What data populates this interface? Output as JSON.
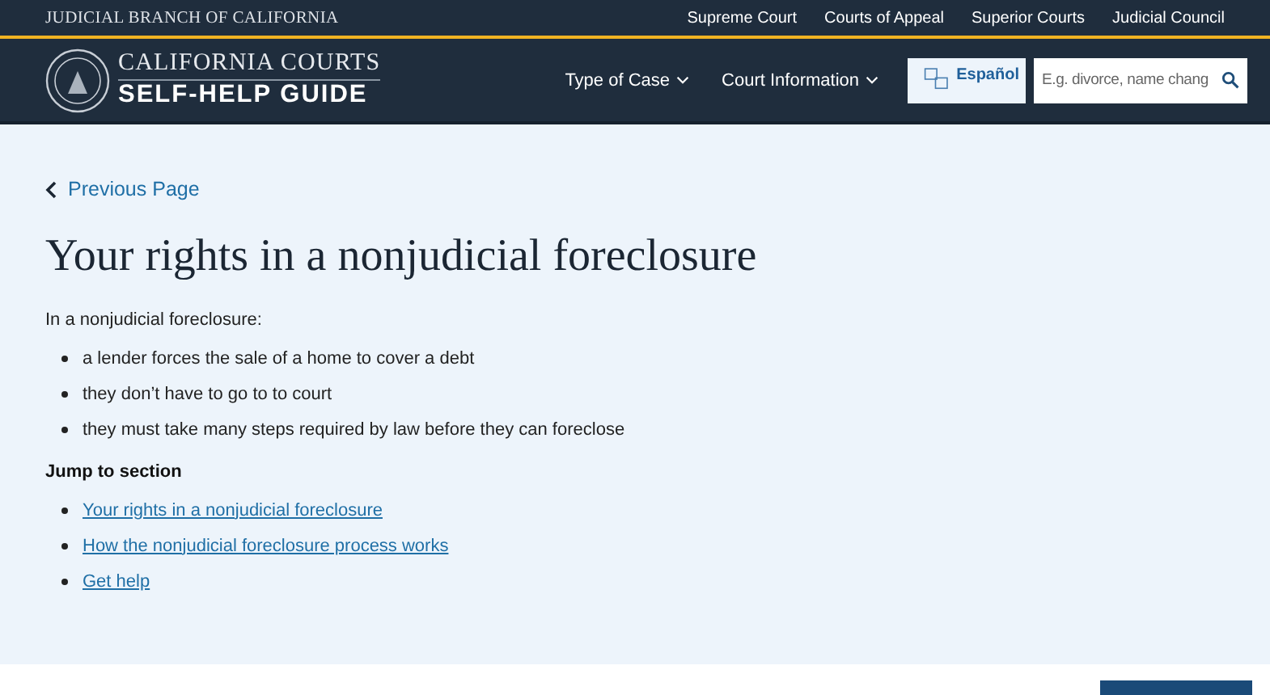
{
  "top_bar": {
    "title": "JUDICIAL BRANCH OF CALIFORNIA",
    "links": [
      "Supreme Court",
      "Courts of Appeal",
      "Superior Courts",
      "Judicial Council"
    ]
  },
  "header": {
    "logo_top": "CALIFORNIA COURTS",
    "logo_bottom": "SELF-HELP GUIDE",
    "menus": [
      "Type of Case",
      "Court Information"
    ],
    "language": "Español",
    "search": {
      "placeholder": "E.g. divorce, name chang"
    }
  },
  "back_link": "Previous Page",
  "title": "Your rights in a nonjudicial foreclosure",
  "intro": "In a nonjudicial foreclosure:",
  "bullets": [
    "a lender forces the sale of a home to cover a debt",
    "they don’t have to go to to court",
    "they must take many steps required by law before they can foreclose"
  ],
  "jump_heading": "Jump to section",
  "jump_links": [
    "Your rights in a nonjudicial foreclosure",
    "How the nonjudicial foreclosure process works",
    "Get help"
  ]
}
